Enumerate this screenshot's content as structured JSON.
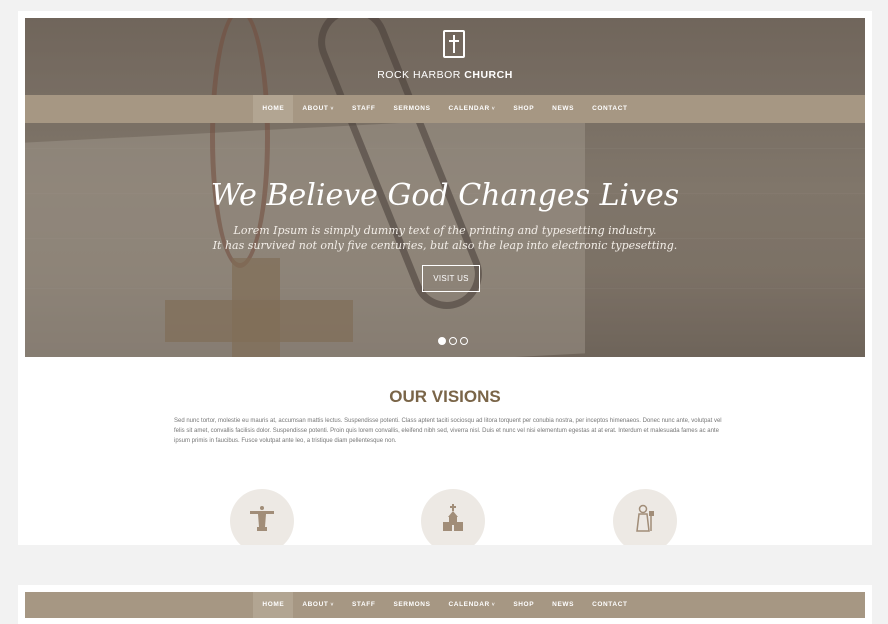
{
  "brand": {
    "name_light": "ROCK HARBOR",
    "name_bold": "CHURCH",
    "icon": "bible-cross-icon"
  },
  "nav": {
    "items": [
      {
        "label": "HOME",
        "active": true,
        "dropdown": false
      },
      {
        "label": "ABOUT",
        "active": false,
        "dropdown": true
      },
      {
        "label": "STAFF",
        "active": false,
        "dropdown": false
      },
      {
        "label": "SERMONS",
        "active": false,
        "dropdown": false
      },
      {
        "label": "CALENDAR",
        "active": false,
        "dropdown": true
      },
      {
        "label": "SHOP",
        "active": false,
        "dropdown": false
      },
      {
        "label": "NEWS",
        "active": false,
        "dropdown": false
      },
      {
        "label": "CONTACT",
        "active": false,
        "dropdown": false
      }
    ],
    "caret": "˅"
  },
  "hero": {
    "headline": "We Believe God Changes Lives",
    "sub1": "Lorem Ipsum is simply dummy text of the printing and typesetting industry.",
    "sub2": "It has survived not only five centuries, but also the leap into electronic typesetting.",
    "button": "VISIT US",
    "slides": 3,
    "active_slide": 1
  },
  "visions": {
    "title": "OUR VISIONS",
    "body": "Sed nunc tortor, molestie eu mauris at, accumsan mattis lectus. Suspendisse potenti. Class aptent taciti sociosqu ad litora torquent per conubia nostra, per inceptos himenaeos. Donec nunc ante, volutpat vel felis sit amet, convallis facilisis dolor. Suspendisse potenti. Proin quis lorem convallis, eleifend nibh sed, viverra nisl. Duis et nunc vel nisi elementum egestas at at erat. Interdum et malesuada fames ac ante ipsum primis in faucibus. Fusce volutpat ante leo, a tristique diam pellentesque non.",
    "icons": [
      "christ-statue-icon",
      "church-icon",
      "saint-figure-icon"
    ]
  },
  "colors": {
    "nav_bg": "#a69783",
    "nav_active": "#b2a592",
    "title": "#7a6548",
    "icon": "#a18d78",
    "icon_bg": "#ede9e4"
  }
}
